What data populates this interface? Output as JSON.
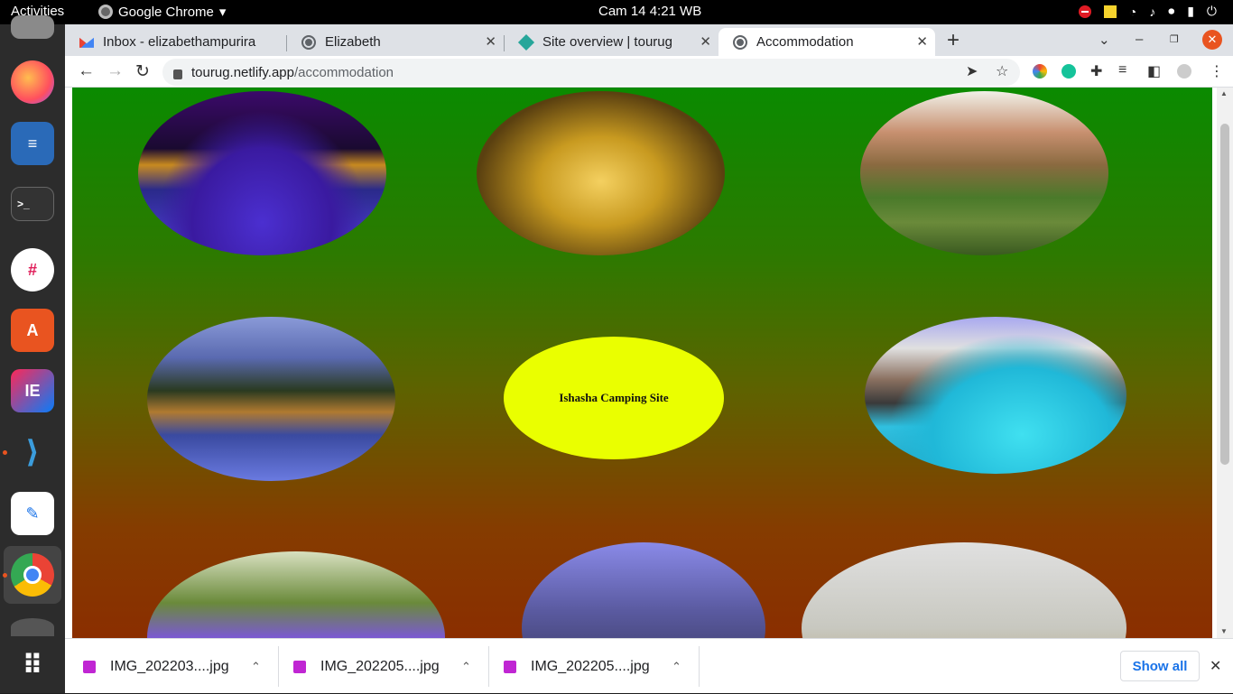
{
  "topbar": {
    "activities": "Activities",
    "app_name": "Google Chrome",
    "app_menu_arrow": "▾",
    "clock": "Cam 14  4:21 WB",
    "tray_icons": [
      "do-not-disturb-icon",
      "notes-icon",
      "wifi-icon",
      "volume-icon",
      "microphone-icon",
      "battery-icon",
      "power-menu-icon"
    ]
  },
  "dock": {
    "apps": [
      "files",
      "firefox",
      "libreoffice-writer",
      "terminal",
      "slack",
      "app-center",
      "intellij-idea",
      "vscode",
      "text-editor",
      "google-chrome",
      "disks"
    ]
  },
  "browser": {
    "tabs": [
      {
        "label": "Inbox - elizabethampurira",
        "favicon": "gmail-icon"
      },
      {
        "label": "Elizabeth",
        "favicon": "globe-icon"
      },
      {
        "label": "Site overview | tourug",
        "favicon": "netlify-icon"
      },
      {
        "label": "Accommodation",
        "favicon": "globe-icon",
        "active": true
      }
    ],
    "tab_close": "✕",
    "new_tab": "+",
    "url_host": "tourug.netlify.app",
    "url_path": "/accommodation",
    "window_controls": {
      "list": "⌄",
      "minimize": "–",
      "restore": "❐",
      "close": "✕"
    },
    "nav": {
      "back": "←",
      "forward": "→",
      "reload": "↻"
    }
  },
  "page": {
    "accommodations": [
      {
        "type": "image",
        "alt": "pool-night-hotel"
      },
      {
        "type": "image",
        "alt": "lit-hotel-palms"
      },
      {
        "type": "image",
        "alt": "hillside-lodge"
      },
      {
        "type": "image",
        "alt": "lodge-dusk-pool"
      },
      {
        "type": "text",
        "label": "Ishasha Camping Site"
      },
      {
        "type": "image",
        "alt": "resort-pool"
      },
      {
        "type": "image",
        "alt": "garden-lodge"
      },
      {
        "type": "image",
        "alt": "dusk-lodge"
      },
      {
        "type": "image",
        "alt": "pale-lodge"
      }
    ],
    "oval_color_text": "#eaff00"
  },
  "downloads": {
    "items": [
      {
        "name": "IMG_202203....jpg"
      },
      {
        "name": "IMG_202205....jpg"
      },
      {
        "name": "IMG_202205....jpg"
      }
    ],
    "chevron": "⌃",
    "show_all": "Show all",
    "close": "✕"
  }
}
